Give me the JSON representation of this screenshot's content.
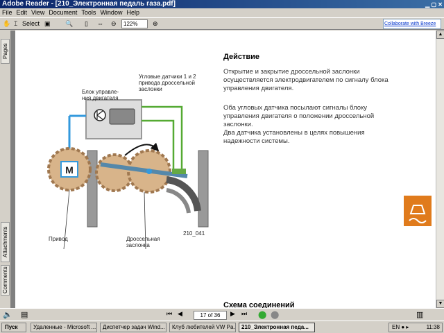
{
  "window": {
    "title": "Adobe Reader - [210_Электронная педаль газа.pdf]"
  },
  "menu": [
    "File",
    "Edit",
    "View",
    "Document",
    "Tools",
    "Window",
    "Help"
  ],
  "toolbar": {
    "select_label": "Select",
    "zoom_value": "122%",
    "collab_label": "Collaborate with Breeze"
  },
  "navpane": {
    "tabs": [
      "Pages",
      "Attachments",
      "Comments"
    ]
  },
  "page": {
    "heading1": "Действие",
    "para1": "Открытие и закрытие дроссельной заслонки осуществляется электродвигателем по сигналу блока управления двигателя.",
    "para2": "Оба угловых датчика посылают сигналы блоку управления двигателя о положении дроссельной заслонки.\nДва датчика установлены в целях повышения надежности системы.",
    "heading2": "Схема соединений",
    "labels": {
      "sensors": "Угловые датчики 1 и 2\nпривода дроссельной\nзаслонки",
      "ecu": "Блок управле-\nния двигателя",
      "drive": "Привод",
      "throttle": "Дроссельная\nзаслонка",
      "figure_id": "210_041",
      "motor_letter": "M"
    }
  },
  "statusbar": {
    "page_indicator": "17 of 36"
  },
  "taskbar": {
    "start_label": "Пуск",
    "tasks": [
      "Удаленные - Microsoft ...",
      "Диспетчер задач Wind...",
      "Клуб любителей VW Pa...",
      "210_Электронная педа..."
    ],
    "clock": "11:38"
  },
  "colors": {
    "accent_orange": "#e07b1c",
    "title_blue": "#0a246a",
    "wire_blue": "#3399dd",
    "wire_green": "#55aa33",
    "gear_tan": "#d8b48a"
  }
}
